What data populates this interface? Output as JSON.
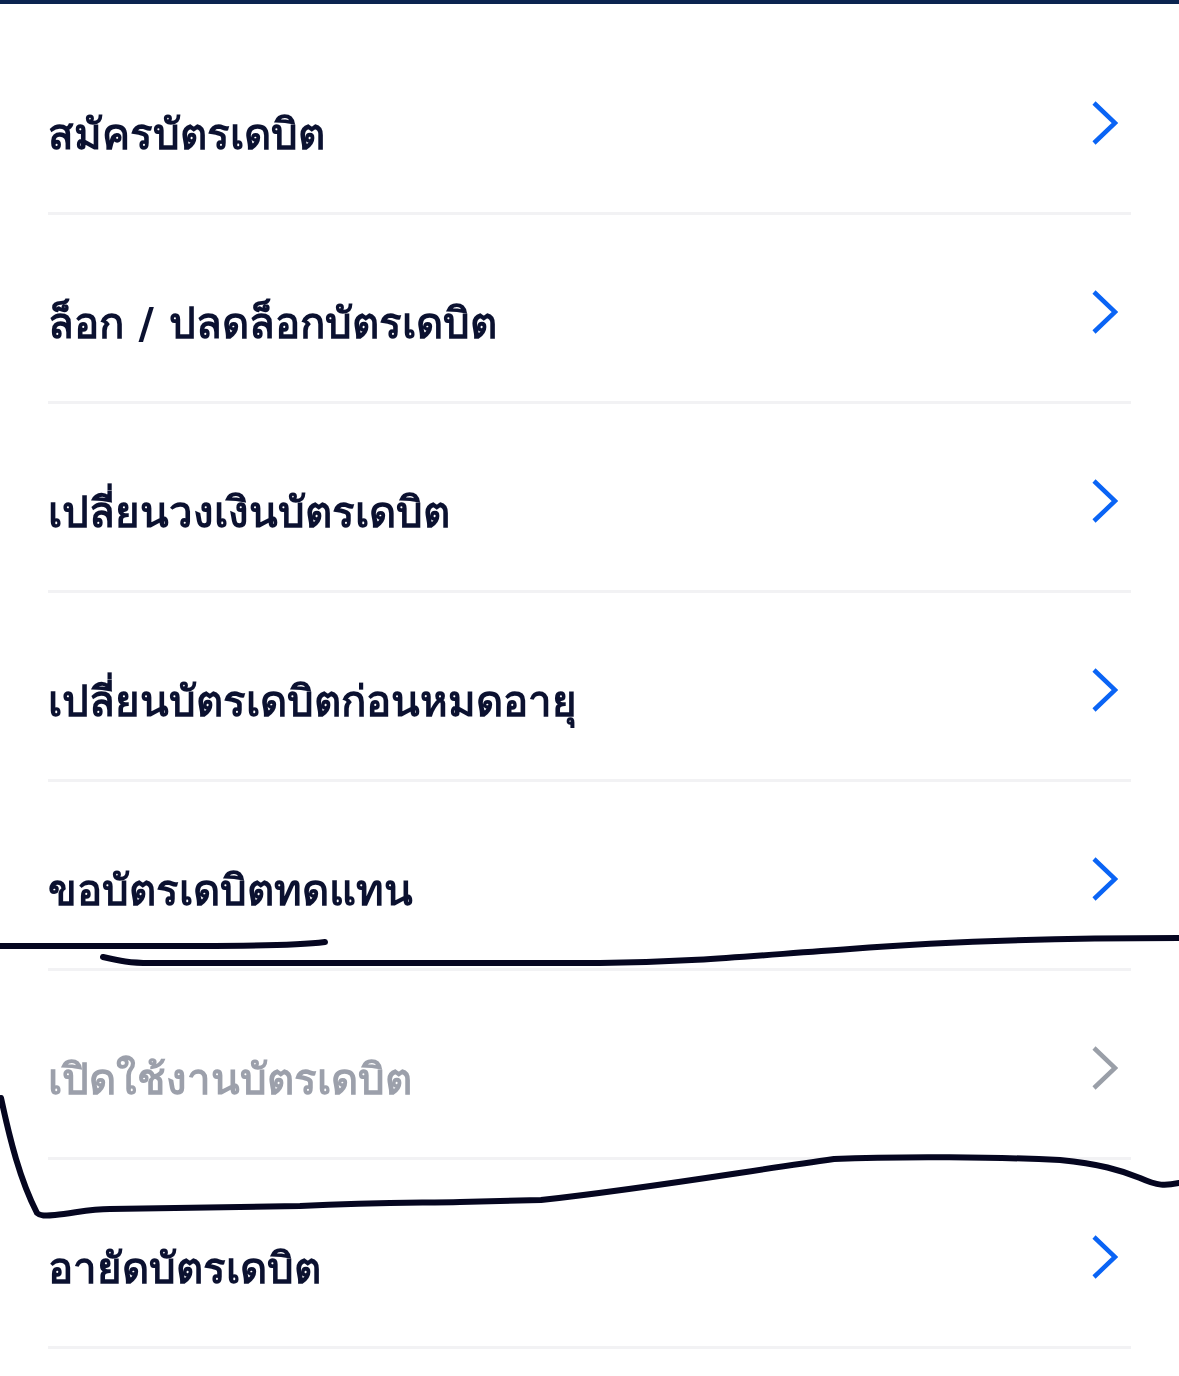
{
  "menu": {
    "items": [
      {
        "label": "สมัครบัตรเดบิต",
        "disabled": false
      },
      {
        "label": "ล็อก / ปลดล็อกบัตรเดบิต",
        "disabled": false
      },
      {
        "label": "เปลี่ยนวงเงินบัตรเดบิต",
        "disabled": false
      },
      {
        "label": "เปลี่ยนบัตรเดบิตก่อนหมดอายุ",
        "disabled": false
      },
      {
        "label": "ขอบัตรเดบิตทดแทน",
        "disabled": false
      },
      {
        "label": "เปิดใช้งานบัตรเดบิต",
        "disabled": true
      },
      {
        "label": "อายัดบัตรเดบิต",
        "disabled": false
      }
    ]
  }
}
